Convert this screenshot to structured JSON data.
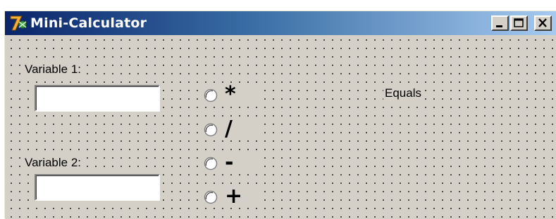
{
  "window": {
    "title": "Mini-Calculator",
    "icon": "app-logo-icon",
    "controls": [
      "minimize-icon",
      "maximize-icon",
      "close-icon"
    ],
    "colors": {
      "titlebar_start": "#0a246a",
      "titlebar_end": "#a6caf0",
      "face": "#d4d0c8"
    }
  },
  "form": {
    "variable1": {
      "label": "Variable 1:",
      "value": ""
    },
    "variable2": {
      "label": "Variable 2:",
      "value": ""
    },
    "operators": [
      {
        "label": "*",
        "selected": false
      },
      {
        "label": "/",
        "selected": false
      },
      {
        "label": "-",
        "selected": false
      },
      {
        "label": "+",
        "selected": false
      }
    ],
    "result": {
      "label": "Equals"
    }
  }
}
